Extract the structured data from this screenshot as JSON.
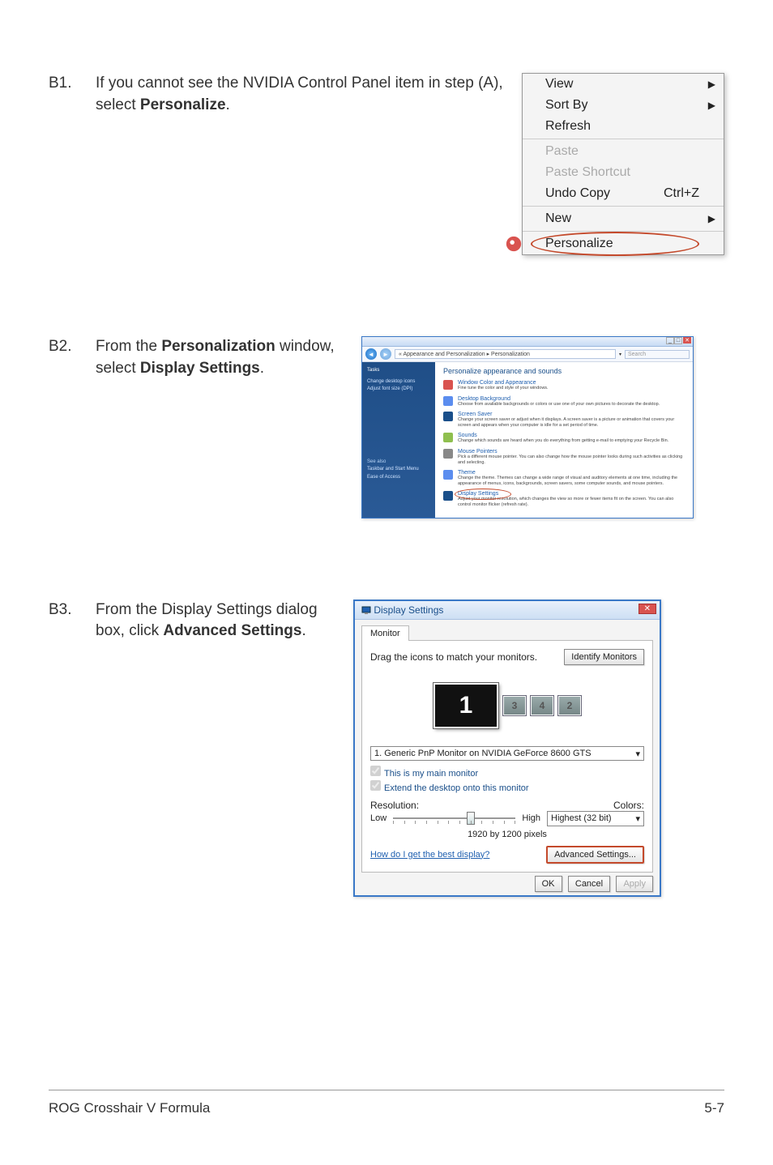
{
  "steps": {
    "b1": {
      "num": "B1.",
      "text_before": "If you cannot see the NVIDIA Control Panel item in step (A), select ",
      "bold": "Personalize",
      "text_after": "."
    },
    "b2": {
      "num": "B2.",
      "text_before": "From the ",
      "bold1": "Personalization",
      "mid": " window, select ",
      "bold2": "Display Settings",
      "text_after": "."
    },
    "b3": {
      "num": "B3.",
      "text_before": "From the Display Settings dialog box, click ",
      "bold": "Advanced Settings",
      "text_after": "."
    }
  },
  "ctxmenu": {
    "view": "View",
    "sortby": "Sort By",
    "refresh": "Refresh",
    "paste": "Paste",
    "paste_shortcut": "Paste Shortcut",
    "undo_copy": "Undo Copy",
    "undo_shortcut": "Ctrl+Z",
    "new": "New",
    "personalize": "Personalize"
  },
  "pw": {
    "breadcrumb": "« Appearance and Personalization  ▸  Personalization",
    "search_placeholder": "Search",
    "side_tasks": "Tasks",
    "side_link1": "Change desktop icons",
    "side_link2": "Adjust font size (DPI)",
    "side_seealso": "See also",
    "side_b1": "Taskbar and Start Menu",
    "side_b2": "Ease of Access",
    "header": "Personalize appearance and sounds",
    "opts": [
      {
        "t": "Window Color and Appearance",
        "d": "Fine tune the color and style of your windows."
      },
      {
        "t": "Desktop Background",
        "d": "Choose from available backgrounds or colors or use one of your own pictures to decorate the desktop."
      },
      {
        "t": "Screen Saver",
        "d": "Change your screen saver or adjust when it displays. A screen saver is a picture or animation that covers your screen and appears when your computer is idle for a set period of time."
      },
      {
        "t": "Sounds",
        "d": "Change which sounds are heard when you do everything from getting e-mail to emptying your Recycle Bin."
      },
      {
        "t": "Mouse Pointers",
        "d": "Pick a different mouse pointer. You can also change how the mouse pointer looks during such activities as clicking and selecting."
      },
      {
        "t": "Theme",
        "d": "Change the theme. Themes can change a wide range of visual and auditory elements at one time, including the appearance of menus, icons, backgrounds, screen savers, some computer sounds, and mouse pointers."
      },
      {
        "t": "Display Settings",
        "d": "Adjust your monitor resolution, which changes the view so more or fewer items fit on the screen. You can also control monitor flicker (refresh rate)."
      }
    ]
  },
  "ds": {
    "title": "Display Settings",
    "tab": "Monitor",
    "drag_text": "Drag the icons to match your monitors.",
    "identify": "Identify Monitors",
    "mon1": "1",
    "mon3": "3",
    "mon4": "4",
    "mon2": "2",
    "select": "1. Generic PnP Monitor on NVIDIA GeForce 8600 GTS",
    "chk_main": "This is my main monitor",
    "chk_extend": "Extend the desktop onto this monitor",
    "resolution_label": "Resolution:",
    "colors_label": "Colors:",
    "low": "Low",
    "high": "High",
    "colors_value": "Highest (32 bit)",
    "res_value": "1920 by 1200 pixels",
    "help_link": "How do I get the best display?",
    "advanced": "Advanced Settings...",
    "ok": "OK",
    "cancel": "Cancel",
    "apply": "Apply"
  },
  "footer": {
    "left": "ROG Crosshair V Formula",
    "right": "5-7"
  }
}
